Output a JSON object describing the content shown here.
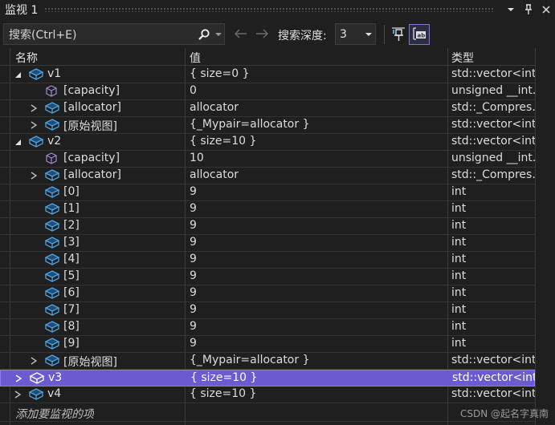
{
  "panel": {
    "title": "监视 1",
    "dropdown_icon": "chevron-down-icon",
    "pin_icon": "pin-icon",
    "close_icon": "close-icon"
  },
  "toolbar": {
    "search_placeholder": "搜索(Ctrl+E)",
    "search_depth_label": "搜索深度:",
    "search_depth_value": "3"
  },
  "columns": {
    "name": "名称",
    "value": "值",
    "type": "类型"
  },
  "rows": [
    {
      "name": "v1",
      "value": "{ size=0 }",
      "type": "std::vector<int...",
      "level": 0,
      "expander": "open",
      "icon": "variable-icon"
    },
    {
      "name": "[capacity]",
      "value": "0",
      "type": "unsigned __int...",
      "level": 1,
      "expander": "none",
      "icon": "property-icon"
    },
    {
      "name": "[allocator]",
      "value": "allocator",
      "type": "std::_Compres...",
      "level": 1,
      "expander": "closed",
      "icon": "variable-icon"
    },
    {
      "name": "[原始视图]",
      "value": "{_Mypair=allocator }",
      "type": "std::vector<int...",
      "level": 1,
      "expander": "closed",
      "icon": "variable-icon"
    },
    {
      "name": "v2",
      "value": "{ size=10 }",
      "type": "std::vector<int...",
      "level": 0,
      "expander": "open",
      "icon": "variable-icon"
    },
    {
      "name": "[capacity]",
      "value": "10",
      "type": "unsigned __int...",
      "level": 1,
      "expander": "none",
      "icon": "property-icon"
    },
    {
      "name": "[allocator]",
      "value": "allocator",
      "type": "std::_Compres...",
      "level": 1,
      "expander": "closed",
      "icon": "variable-icon"
    },
    {
      "name": "[0]",
      "value": "9",
      "type": "int",
      "level": 1,
      "expander": "none",
      "icon": "variable-icon"
    },
    {
      "name": "[1]",
      "value": "9",
      "type": "int",
      "level": 1,
      "expander": "none",
      "icon": "variable-icon"
    },
    {
      "name": "[2]",
      "value": "9",
      "type": "int",
      "level": 1,
      "expander": "none",
      "icon": "variable-icon"
    },
    {
      "name": "[3]",
      "value": "9",
      "type": "int",
      "level": 1,
      "expander": "none",
      "icon": "variable-icon"
    },
    {
      "name": "[4]",
      "value": "9",
      "type": "int",
      "level": 1,
      "expander": "none",
      "icon": "variable-icon"
    },
    {
      "name": "[5]",
      "value": "9",
      "type": "int",
      "level": 1,
      "expander": "none",
      "icon": "variable-icon"
    },
    {
      "name": "[6]",
      "value": "9",
      "type": "int",
      "level": 1,
      "expander": "none",
      "icon": "variable-icon"
    },
    {
      "name": "[7]",
      "value": "9",
      "type": "int",
      "level": 1,
      "expander": "none",
      "icon": "variable-icon"
    },
    {
      "name": "[8]",
      "value": "9",
      "type": "int",
      "level": 1,
      "expander": "none",
      "icon": "variable-icon"
    },
    {
      "name": "[9]",
      "value": "9",
      "type": "int",
      "level": 1,
      "expander": "none",
      "icon": "variable-icon"
    },
    {
      "name": "[原始视图]",
      "value": "{_Mypair=allocator }",
      "type": "std::vector<int...",
      "level": 1,
      "expander": "closed",
      "icon": "variable-icon"
    },
    {
      "name": "v3",
      "value": "{ size=10 }",
      "type": "std::vector<int...",
      "level": 0,
      "expander": "closed",
      "icon": "variable-icon",
      "selected": true
    },
    {
      "name": "v4",
      "value": "{ size=10 }",
      "type": "std::vector<int...",
      "level": 0,
      "expander": "closed",
      "icon": "variable-icon"
    }
  ],
  "add_watch_placeholder": "添加要监视的项",
  "watermark": "CSDN @起名字真南",
  "colors": {
    "background": "#1f1f1f",
    "selection": "#6b5bd1",
    "icon_blue": "#4fa3e0",
    "icon_purple": "#a889d9"
  }
}
